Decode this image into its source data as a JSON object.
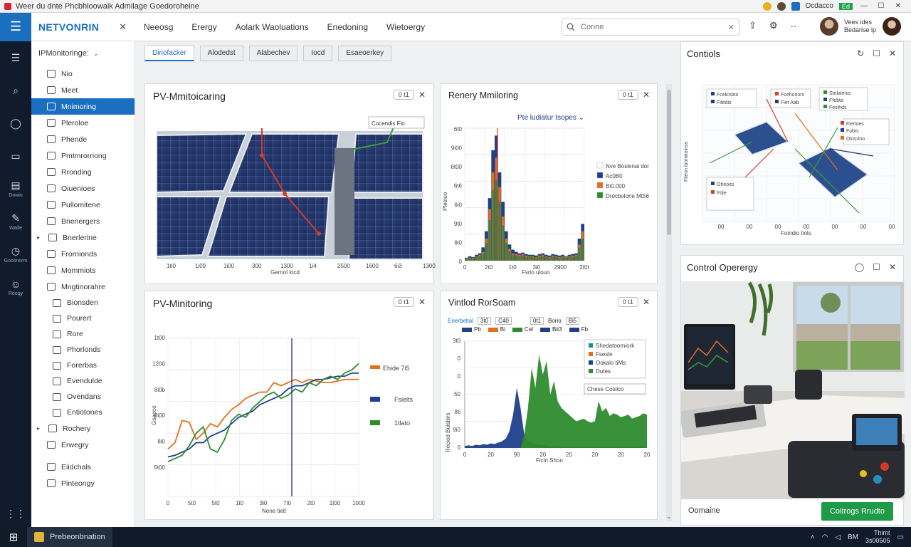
{
  "window": {
    "title": "Weer du dnte Phcbhloowaik Admilage Goedoroheine"
  },
  "titlebar": {
    "badge": "Ed",
    "account": "Ocdacco"
  },
  "header": {
    "brand": "NETVONRIN",
    "nav": [
      "Neeosg",
      "Erergy",
      "Aolark Waoluations",
      "Enedoning",
      "Wietoergy"
    ],
    "search_placeholder": "Conne",
    "user_name": "Vees ides Bedarise ip"
  },
  "rail": [
    {
      "icon": "menu-icon",
      "label": ""
    },
    {
      "icon": "search-icon",
      "label": ""
    },
    {
      "icon": "chat-icon",
      "label": ""
    },
    {
      "icon": "folder-icon",
      "label": ""
    },
    {
      "icon": "document-icon",
      "label": "Dowio"
    },
    {
      "icon": "wrench-icon",
      "label": "Wade"
    },
    {
      "icon": "clock-icon",
      "label": "Goosnorm"
    },
    {
      "icon": "people-icon",
      "label": "Roogy"
    }
  ],
  "tree": {
    "header": "IPMonitoringe:",
    "items": [
      {
        "label": "Nio",
        "type": "row"
      },
      {
        "label": "Meet",
        "type": "row"
      },
      {
        "label": "Mnimoring",
        "type": "active"
      },
      {
        "label": "Pleroloe",
        "type": "row"
      },
      {
        "label": "Phende",
        "type": "row"
      },
      {
        "label": "Pmtmrorriong",
        "type": "row"
      },
      {
        "label": "Rronding",
        "type": "row"
      },
      {
        "label": "Oiuenioes",
        "type": "row"
      },
      {
        "label": "Pullomitene",
        "type": "row"
      },
      {
        "label": "Bnenergers",
        "type": "row"
      },
      {
        "label": "Bnerlerine",
        "type": "group"
      },
      {
        "label": "Frornionds",
        "type": "row"
      },
      {
        "label": "Mommiots",
        "type": "row"
      },
      {
        "label": "Mngtinorahre",
        "type": "row"
      },
      {
        "label": "Bionsden",
        "type": "sub"
      },
      {
        "label": "Pourert",
        "type": "sub"
      },
      {
        "label": "Rore",
        "type": "sub"
      },
      {
        "label": "Phorlonds",
        "type": "sub"
      },
      {
        "label": "Forerbas",
        "type": "sub"
      },
      {
        "label": "Evendulde",
        "type": "sub"
      },
      {
        "label": "Ovendans",
        "type": "sub"
      },
      {
        "label": "Entiotones",
        "type": "sub"
      },
      {
        "label": "Rochery",
        "type": "group"
      },
      {
        "label": "Erwegry",
        "type": "row"
      },
      {
        "label": "Eiidchals",
        "type": "row"
      },
      {
        "label": "Pinteongy",
        "type": "row"
      }
    ]
  },
  "tabs": [
    "Diriofacker",
    "Alodedst",
    "Alabechev",
    "Iocd",
    "Esaeoerkey"
  ],
  "cards": {
    "pv_top": {
      "title": "PV-Mmitoicaring",
      "pill": "0   t1",
      "legend": "Cocendis   Fio",
      "ticks": [
        "1ti0",
        "1i09",
        "1i00",
        "300",
        "1300",
        "1i4",
        "2500",
        "1600",
        "6i3",
        "1300"
      ],
      "xlabel": "Gernol locd"
    },
    "renery": {
      "title": "Renery Mmiloring",
      "pill": "0   t1",
      "subtitle": "Pte ludiatur tsopes",
      "ylabel": "Plesiuo",
      "yticks": [
        "6t0",
        "9i00",
        "6t00",
        "6t6",
        "6i0",
        "9t0",
        "6i0",
        "0"
      ],
      "xticks": [
        "0",
        "2t0",
        "1t0",
        "3i0",
        "2900",
        "2t0t"
      ],
      "xlabel": "Fsrio ulouo",
      "legend": [
        "Nve Boslenai dor",
        "Ac0B0",
        "Bi0.000",
        "Drecbolohe Mt56"
      ]
    },
    "pv_bottom": {
      "title": "PV-Minitoring",
      "pill": "0   t1",
      "yticks": [
        "1t00",
        "1200",
        "8i0b",
        "8i00",
        "8i0",
        "6t00"
      ],
      "xticks": [
        "0",
        "5t0",
        "5t0",
        "1t0",
        "3i0",
        "7t0",
        "2t0",
        "1t00",
        "1000"
      ],
      "xlabel": "Nene tietl",
      "ylabel": "Gsaeco",
      "legend": [
        "Ehide   7i5",
        "Fsielts",
        "1tlato"
      ]
    },
    "vintod": {
      "title": "Vintlod RorSoam",
      "pill": "0   t1",
      "series_header": "Enerbetial",
      "chips": [
        "3t0",
        "C40",
        "0t1",
        "Borio",
        "Bi5"
      ],
      "subchips": [
        "Pb",
        "Bi",
        "Cel",
        "Bit3",
        "Fb"
      ],
      "yticks": [
        "3t0",
        "0",
        "0",
        "50",
        "8ti",
        "9i0",
        "0"
      ],
      "xticks": [
        "0",
        "20",
        "90",
        "20",
        "20",
        "20",
        "20",
        "20"
      ],
      "xlabel": "Ficin Shon",
      "ylabel": "Reciod Bulsbirs",
      "legend": [
        "Shedatoorniork",
        "Fsesle",
        "Ookalo tiMs",
        "Dutes"
      ],
      "annotation": "Chese  Coslico"
    }
  },
  "right": {
    "controls": {
      "title": "Contiols",
      "labels": [
        "Fcekinbto",
        "Fitedis",
        "Fcehorlors",
        "Fiet Aab",
        "Stelalenis",
        "Ffebta",
        "Fesihds",
        "Fierloes",
        "Fobts",
        "Oinsrino",
        "Oheoes",
        "Fdie"
      ],
      "ticks": [
        "00",
        "00",
        "00",
        "00",
        "00",
        "00",
        "00"
      ],
      "xlabel": "Foindio tiols",
      "ylabel": "Fileon biomitoinss"
    },
    "operergy": {
      "title": "Control Operergy",
      "footer": "Oomaine",
      "button": "Coitrogs Rrudto"
    }
  },
  "taskbar": {
    "app": "Prebeonbnation",
    "clock": "Thimt\n3s00505",
    "lang": "BM"
  },
  "colors": {
    "accent": "#1a6fc1",
    "green": "#2e8b2e",
    "orange": "#e07020",
    "navy": "#1f3f8a"
  },
  "chart_data": [
    {
      "type": "bar",
      "title": "Renery Mmiloring",
      "subtitle": "Pte ludiatur tsopes",
      "ylabel": "Plesiuo",
      "xlabel": "Fsrio ulouo",
      "categories": [
        "0",
        "1",
        "2",
        "3",
        "4",
        "5",
        "6",
        "7",
        "8",
        "9",
        "10",
        "11",
        "12",
        "13",
        "14",
        "15",
        "16",
        "17",
        "18",
        "19",
        "20",
        "21",
        "22",
        "23",
        "24",
        "25",
        "26",
        "27",
        "28",
        "29",
        "30",
        "31",
        "32",
        "33",
        "34",
        "35"
      ],
      "series": [
        {
          "name": "Ac0B0",
          "values": [
            4,
            6,
            5,
            8,
            10,
            18,
            40,
            85,
            150,
            170,
            120,
            80,
            40,
            22,
            15,
            12,
            10,
            11,
            9,
            8,
            8,
            7,
            9,
            10,
            8,
            7,
            9,
            8,
            7,
            8,
            6,
            8,
            9,
            10,
            30,
            50
          ]
        },
        {
          "name": "Bi0.000",
          "values": [
            3,
            4,
            4,
            6,
            8,
            12,
            30,
            70,
            120,
            140,
            100,
            60,
            30,
            16,
            10,
            9,
            8,
            9,
            7,
            6,
            6,
            5,
            7,
            8,
            6,
            5,
            7,
            6,
            5,
            6,
            5,
            6,
            7,
            8,
            22,
            40
          ]
        },
        {
          "name": "Drecbolohe Mt56",
          "values": [
            2,
            3,
            3,
            5,
            6,
            10,
            24,
            55,
            96,
            110,
            80,
            48,
            24,
            12,
            8,
            7,
            6,
            7,
            5,
            5,
            5,
            4,
            5,
            6,
            5,
            4,
            5,
            5,
            4,
            5,
            4,
            5,
            5,
            6,
            18,
            30
          ]
        }
      ],
      "ylim": [
        0,
        180
      ]
    },
    {
      "type": "line",
      "title": "PV-Minitoring",
      "xlabel": "Nene tietl",
      "ylabel": "Gsaeco",
      "x": [
        0,
        1,
        2,
        3,
        4,
        5,
        6,
        7,
        8,
        9,
        10,
        11,
        12,
        13,
        14,
        15,
        16,
        17,
        18,
        19,
        20,
        21,
        22,
        23,
        24,
        25,
        26,
        27
      ],
      "series": [
        {
          "name": "Ehide   7i5",
          "values": [
            30,
            34,
            48,
            47,
            36,
            40,
            46,
            44,
            50,
            55,
            58,
            62,
            64,
            66,
            66,
            72,
            70,
            72,
            74,
            72,
            74,
            73,
            72,
            72,
            73,
            74,
            74,
            74
          ]
        },
        {
          "name": "Fsielts",
          "values": [
            25,
            26,
            28,
            30,
            34,
            34,
            38,
            40,
            42,
            46,
            50,
            52,
            54,
            58,
            60,
            62,
            64,
            68,
            70,
            70,
            72,
            74,
            74,
            75,
            76,
            76,
            78,
            78
          ]
        },
        {
          "name": "1tlato",
          "values": [
            22,
            24,
            26,
            32,
            40,
            44,
            30,
            28,
            36,
            48,
            52,
            50,
            56,
            60,
            64,
            66,
            62,
            64,
            68,
            66,
            72,
            70,
            74,
            76,
            74,
            78,
            80,
            84
          ]
        }
      ],
      "ylim": [
        0,
        100
      ]
    },
    {
      "type": "area",
      "title": "Vintlod RorSoam",
      "xlabel": "Ficin Shon",
      "ylabel": "Reciod Bulsbirs",
      "x": [
        0,
        1,
        2,
        3,
        4,
        5,
        6,
        7,
        8,
        9,
        10,
        11,
        12,
        13,
        14,
        15,
        16,
        17,
        18,
        19,
        20,
        21,
        22,
        23,
        24,
        25,
        26,
        27,
        28,
        29,
        30,
        31,
        32,
        33,
        34,
        35,
        36,
        37,
        38,
        39,
        40,
        41,
        42,
        43,
        44,
        45,
        46,
        47,
        48,
        49
      ],
      "series": [
        {
          "name": "Shedatoorniork",
          "values": [
            3,
            4,
            3,
            5,
            4,
            6,
            5,
            7,
            6,
            8,
            10,
            14,
            25,
            50,
            90,
            60,
            20,
            10,
            8,
            6,
            5,
            4,
            4,
            3,
            3,
            3,
            3,
            2,
            2,
            2,
            2,
            2,
            2,
            2,
            2,
            2,
            2,
            2,
            2,
            2,
            2,
            2,
            2,
            2,
            2,
            2,
            2,
            2,
            2,
            2
          ]
        },
        {
          "name": "Dutes",
          "values": [
            0,
            0,
            0,
            0,
            0,
            0,
            0,
            0,
            0,
            0,
            0,
            0,
            0,
            0,
            0,
            0,
            20,
            60,
            120,
            90,
            140,
            110,
            130,
            80,
            100,
            70,
            60,
            55,
            50,
            45,
            40,
            42,
            44,
            40,
            38,
            40,
            70,
            55,
            60,
            48,
            52,
            50,
            46,
            48,
            50,
            44,
            46,
            48,
            52,
            50
          ]
        }
      ],
      "ylim": [
        0,
        160
      ]
    }
  ]
}
